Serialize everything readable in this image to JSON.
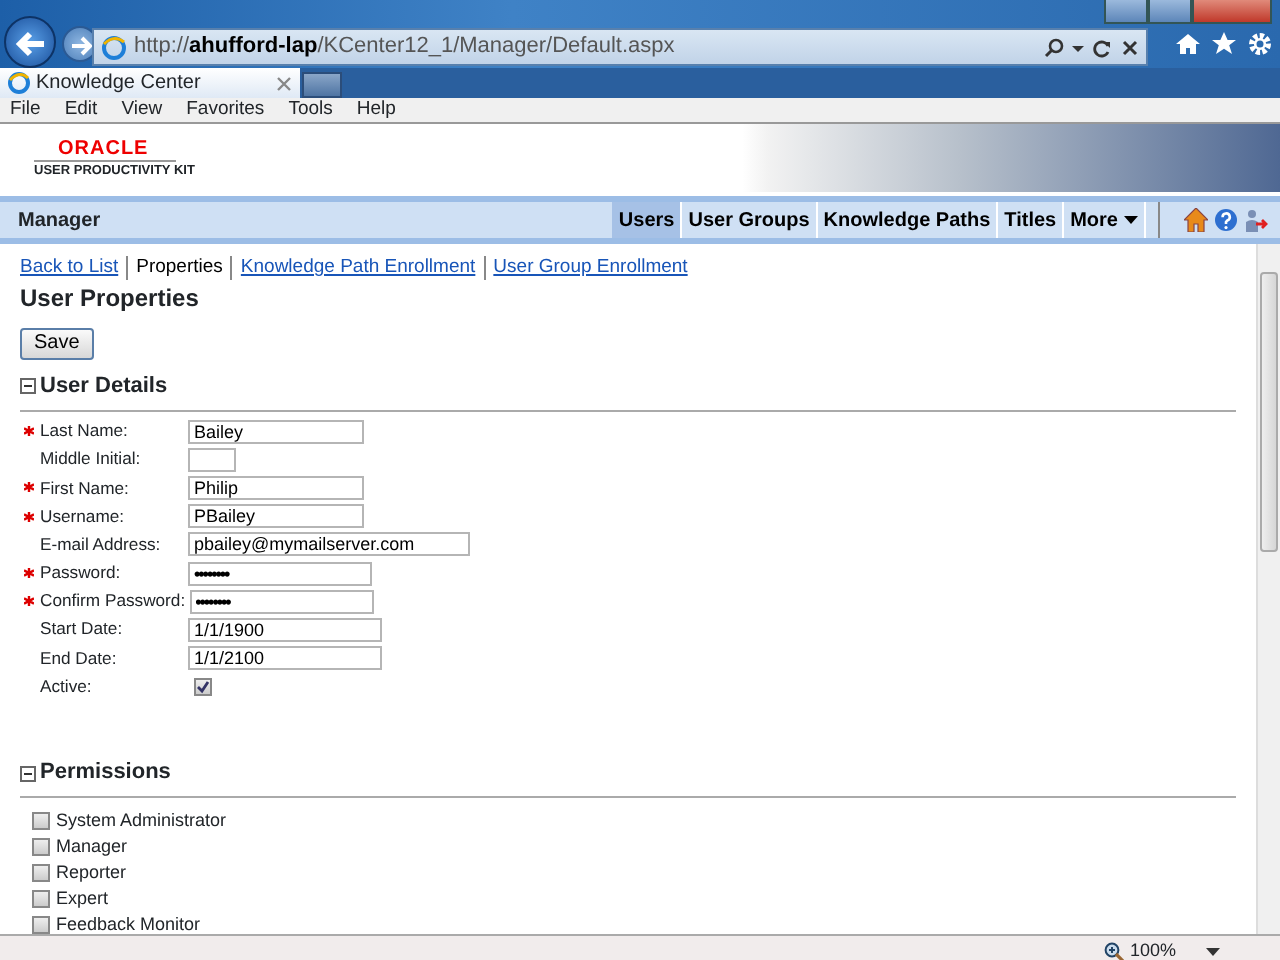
{
  "browser": {
    "url": "http://**ahufford-lap**/KCenter12_1/Manager/Default.aspx",
    "tab_title": "Knowledge Center",
    "menu": [
      "File",
      "Edit",
      "View",
      "Favorites",
      "Tools",
      "Help"
    ]
  },
  "app": {
    "logo": "ORACLE",
    "logo_subtitle": "USER PRODUCTIVITY KIT",
    "section_title": "Manager",
    "nav": [
      {
        "label": "Users",
        "selected": true
      },
      {
        "label": "User Groups",
        "selected": false
      },
      {
        "label": "Knowledge Paths",
        "selected": false
      },
      {
        "label": "Titles",
        "selected": false
      },
      {
        "label": "More",
        "selected": false
      }
    ],
    "subnav": [
      {
        "label": "Back to List",
        "selected": false
      },
      {
        "label": "Properties",
        "selected": true
      },
      {
        "label": "Knowledge Path Enrollment",
        "selected": false
      },
      {
        "label": "User Group Enrollment",
        "selected": false
      }
    ],
    "page_title": "User Properties",
    "save_button": "Save",
    "user_details": {
      "title": "User Details",
      "expanded": true,
      "fields": [
        {
          "label": "Last Name:",
          "required": true,
          "kind": "text",
          "value": "Bailey"
        },
        {
          "label": "Middle Initial:",
          "required": false,
          "kind": "initial"
        },
        {
          "label": "First Name:",
          "required": true,
          "kind": "text",
          "value": "Philip"
        },
        {
          "label": "Username:",
          "required": true,
          "kind": "text",
          "value": "PBailey"
        },
        {
          "label": "E-mail Address:",
          "required": false,
          "kind": "email",
          "value": "pbailey@mymailserver.com"
        },
        {
          "label": "Password:",
          "required": true,
          "kind": "password",
          "value": "••••••••"
        },
        {
          "label": "Confirm Password:",
          "required": true,
          "kind": "password",
          "value": "••••••••"
        },
        {
          "label": "Start Date:",
          "required": false,
          "kind": "date",
          "value": "1/1/1900"
        },
        {
          "label": "End Date:",
          "required": false,
          "kind": "date",
          "value": "1/1/2100"
        },
        {
          "label": "Active:",
          "required": false,
          "kind": "checkbox",
          "checked": true
        }
      ]
    },
    "permissions": {
      "title": "Permissions",
      "expanded": true,
      "items": [
        {
          "label": "System Administrator",
          "checked": false
        },
        {
          "label": "Manager",
          "checked": false
        },
        {
          "label": "Reporter",
          "checked": false
        },
        {
          "label": "Expert",
          "checked": false
        },
        {
          "label": "Feedback Monitor",
          "checked": false
        }
      ]
    }
  },
  "status_bar": {
    "zoom": "100%"
  }
}
